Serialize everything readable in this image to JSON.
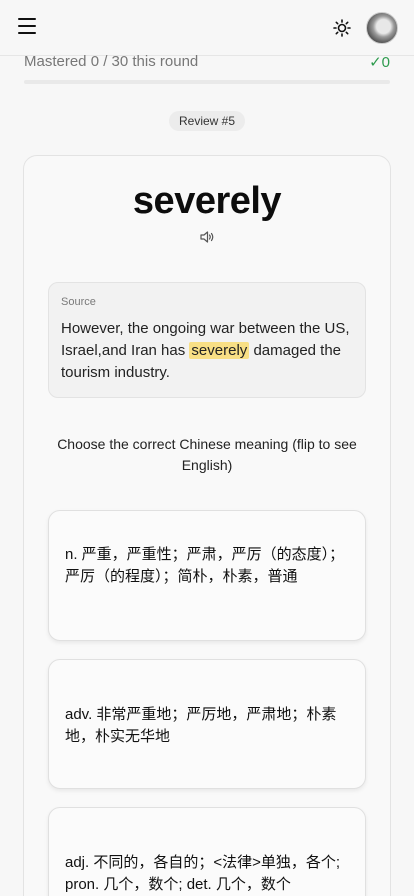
{
  "header": {
    "menu_icon": "hamburger-menu-icon",
    "theme_icon": "sun-icon",
    "avatar_icon": "user-avatar"
  },
  "progress": {
    "label": "Mastered 0 / 30 this round",
    "count": "✓0",
    "mastered": 0,
    "total": 30,
    "fill_fraction": 0,
    "accent_color": "#2e9b4e"
  },
  "review_badge": "Review #5",
  "word": {
    "text": "severely",
    "speaker_icon": "speaker-icon"
  },
  "source": {
    "label": "Source",
    "sentence_before": "However, the ongoing war between the US, Israel,and Iran has ",
    "highlight": "severely",
    "sentence_after": " damaged the tourism industry.",
    "highlight_color": "#f8df85"
  },
  "instruction": "Choose the correct Chinese meaning (flip to see English)",
  "options": [
    {
      "text": "n. 严重，严重性；严肃，严厉（的态度）；严厉（的程度）；简朴，朴素，普通"
    },
    {
      "text": "adv. 非常严重地；严厉地，严肃地；朴素地，朴实无华地"
    },
    {
      "text": "adj. 不同的，各自的；<法律>单独，各个; pron. 几个，数个; det. 几个，数个"
    }
  ]
}
